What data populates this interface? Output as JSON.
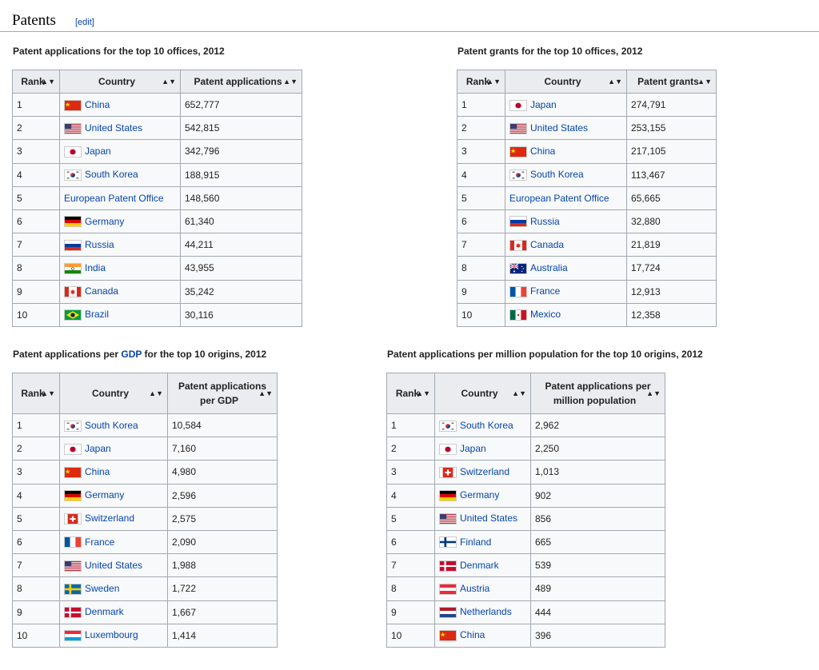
{
  "section": {
    "title": "Patents",
    "edit": "[edit]"
  },
  "tables": [
    {
      "caption": "Patent applications for the top 10 offices, 2012",
      "headers": [
        "Rank",
        "Country",
        "Patent applications"
      ],
      "rows": [
        {
          "rank": "1",
          "country": "China",
          "flag": "china",
          "value": "652,777"
        },
        {
          "rank": "2",
          "country": "United States",
          "flag": "us",
          "value": "542,815"
        },
        {
          "rank": "3",
          "country": "Japan",
          "flag": "japan",
          "value": "342,796"
        },
        {
          "rank": "4",
          "country": "South Korea",
          "flag": "south-korea",
          "value": "188,915"
        },
        {
          "rank": "5",
          "country": "European Patent Office",
          "flag": "",
          "value": "148,560"
        },
        {
          "rank": "6",
          "country": "Germany",
          "flag": "germany",
          "value": "61,340"
        },
        {
          "rank": "7",
          "country": "Russia",
          "flag": "russia",
          "value": "44,211"
        },
        {
          "rank": "8",
          "country": "India",
          "flag": "india",
          "value": "43,955"
        },
        {
          "rank": "9",
          "country": "Canada",
          "flag": "canada",
          "value": "35,242"
        },
        {
          "rank": "10",
          "country": "Brazil",
          "flag": "brazil",
          "value": "30,116"
        }
      ]
    },
    {
      "caption": "Patent grants for the top 10 offices, 2012",
      "headers": [
        "Rank",
        "Country",
        "Patent grants"
      ],
      "rows": [
        {
          "rank": "1",
          "country": "Japan",
          "flag": "japan",
          "value": "274,791"
        },
        {
          "rank": "2",
          "country": "United States",
          "flag": "us",
          "value": "253,155"
        },
        {
          "rank": "3",
          "country": "China",
          "flag": "china",
          "value": "217,105"
        },
        {
          "rank": "4",
          "country": "South Korea",
          "flag": "south-korea",
          "value": "113,467"
        },
        {
          "rank": "5",
          "country": "European Patent Office",
          "flag": "",
          "value": "65,665"
        },
        {
          "rank": "6",
          "country": "Russia",
          "flag": "russia",
          "value": "32,880"
        },
        {
          "rank": "7",
          "country": "Canada",
          "flag": "canada",
          "value": "21,819"
        },
        {
          "rank": "8",
          "country": "Australia",
          "flag": "australia",
          "value": "17,724"
        },
        {
          "rank": "9",
          "country": "France",
          "flag": "france",
          "value": "12,913"
        },
        {
          "rank": "10",
          "country": "Mexico",
          "flag": "mexico",
          "value": "12,358"
        }
      ]
    },
    {
      "caption_parts": [
        "Patent applications per ",
        "GDP",
        " for the top 10 origins, 2012"
      ],
      "headers": [
        "Rank",
        "Country",
        "Patent applications per GDP"
      ],
      "rows": [
        {
          "rank": "1",
          "country": "South Korea",
          "flag": "south-korea",
          "value": "10,584"
        },
        {
          "rank": "2",
          "country": "Japan",
          "flag": "japan",
          "value": "7,160"
        },
        {
          "rank": "3",
          "country": "China",
          "flag": "china",
          "value": "4,980"
        },
        {
          "rank": "4",
          "country": "Germany",
          "flag": "germany",
          "value": "2,596"
        },
        {
          "rank": "5",
          "country": "Switzerland",
          "flag": "switzerland",
          "value": "2,575"
        },
        {
          "rank": "6",
          "country": "France",
          "flag": "france",
          "value": "2,090"
        },
        {
          "rank": "7",
          "country": "United States",
          "flag": "us",
          "value": "1,988"
        },
        {
          "rank": "8",
          "country": "Sweden",
          "flag": "sweden",
          "value": "1,722"
        },
        {
          "rank": "9",
          "country": "Denmark",
          "flag": "denmark",
          "value": "1,667"
        },
        {
          "rank": "10",
          "country": "Luxembourg",
          "flag": "luxembourg",
          "value": "1,414"
        }
      ]
    },
    {
      "caption": "Patent applications per million population for the top 10 origins, 2012",
      "headers": [
        "Rank",
        "Country",
        "Patent applications per million population"
      ],
      "rows": [
        {
          "rank": "1",
          "country": "South Korea",
          "flag": "south-korea",
          "value": "2,962"
        },
        {
          "rank": "2",
          "country": "Japan",
          "flag": "japan",
          "value": "2,250"
        },
        {
          "rank": "3",
          "country": "Switzerland",
          "flag": "switzerland",
          "value": "1,013"
        },
        {
          "rank": "4",
          "country": "Germany",
          "flag": "germany",
          "value": "902"
        },
        {
          "rank": "5",
          "country": "United States",
          "flag": "us",
          "value": "856"
        },
        {
          "rank": "6",
          "country": "Finland",
          "flag": "finland",
          "value": "665"
        },
        {
          "rank": "7",
          "country": "Denmark",
          "flag": "denmark",
          "value": "539"
        },
        {
          "rank": "8",
          "country": "Austria",
          "flag": "austria",
          "value": "489"
        },
        {
          "rank": "9",
          "country": "Netherlands",
          "flag": "netherlands",
          "value": "444"
        },
        {
          "rank": "10",
          "country": "China",
          "flag": "china",
          "value": "396"
        }
      ]
    }
  ]
}
